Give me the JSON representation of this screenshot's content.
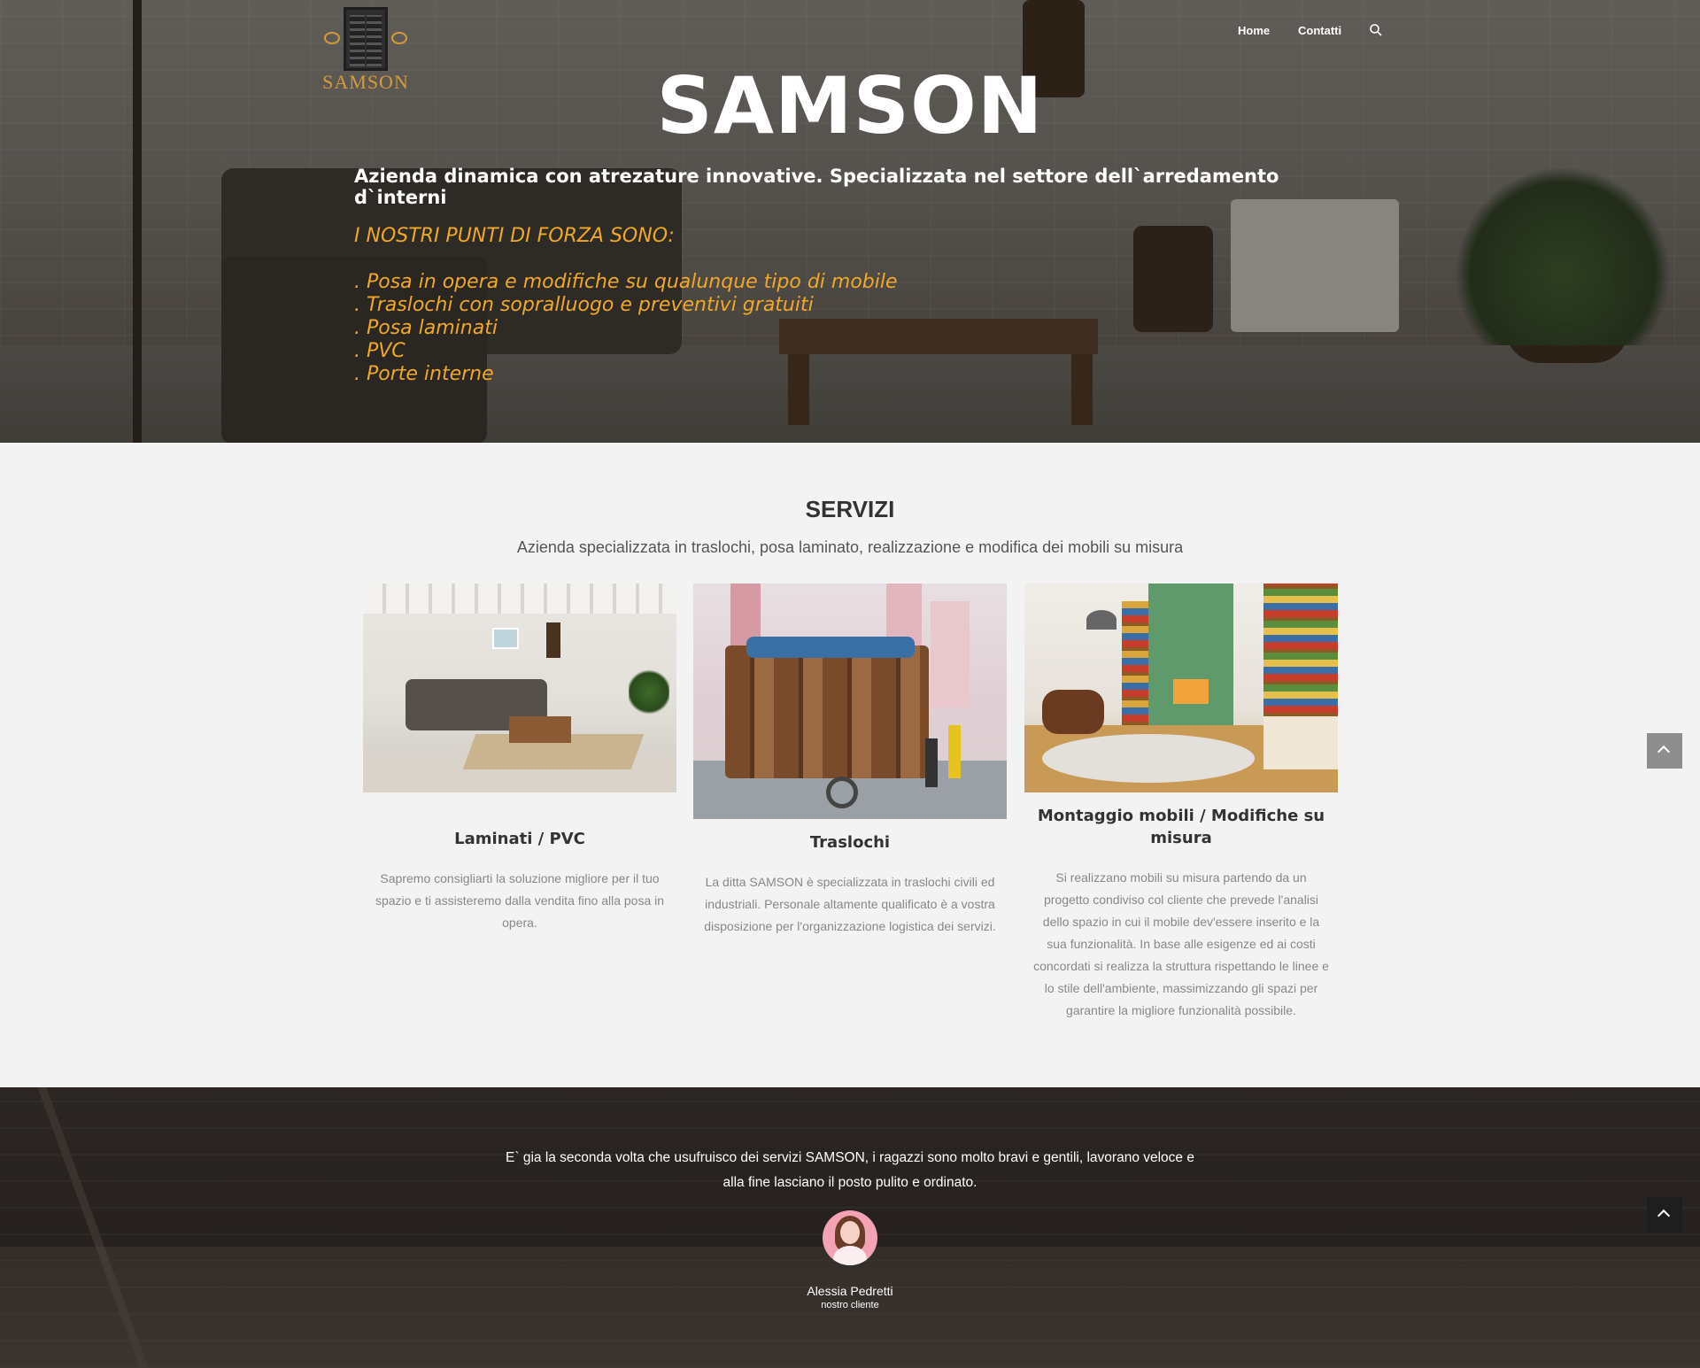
{
  "header": {
    "logo_text": "SAMSON",
    "nav": {
      "home": "Home",
      "contatti": "Contatti"
    },
    "search_icon": "search-icon"
  },
  "hero": {
    "title": "SAMSON",
    "subtitle": "Azienda dinamica con atrezature innovative. Specializzata nel settore dell`arredamento d`interni",
    "strengths_heading": "I NOSTRI PUNTI DI FORZA SONO:",
    "strengths": [
      ". Posa in opera e modifiche su qualunque tipo di mobile",
      ". Traslochi con sopralluogo e preventivi gratuiti",
      ". Posa laminati",
      ". PVC",
      ". Porte interne"
    ],
    "accent_color": "#f0a826"
  },
  "services": {
    "title": "SERVIZI",
    "subtitle": "Azienda specializzata in traslochi, posa laminato, realizzazione e modifica dei mobili su misura",
    "cards": [
      {
        "title": "Laminati / PVC",
        "text": "Sapremo consigliarti la soluzione migliore per il tuo spazio e ti assisteremo dalla vendita fino alla posa in opera."
      },
      {
        "title": "Traslochi",
        "text": "La ditta SAMSON è specializzata in traslochi civili ed industriali. Personale altamente qualificato è a vostra disposizione per l'organizzazione logistica dei servizi."
      },
      {
        "title": "Montaggio mobili / Modifiche su misura",
        "text": "Si realizzano mobili su misura partendo da un progetto condiviso col cliente che prevede l'analisi dello spazio in cui il mobile dev'essere inserito e la sua funzionalità. In base alle esigenze ed ai costi concordati si realizza la struttura rispettando le linee e lo stile dell'ambiente, massimizzando gli spazi per garantire la migliore funzionalità possibile."
      }
    ]
  },
  "testimonial": {
    "quote": "E` gia la seconda volta che usufruisco dei servizi SAMSON, i ragazzi sono molto bravi e gentili, lavorano veloce e alla fine lasciano il posto pulito e ordinato.",
    "author": "Alessia Pedretti",
    "role": "nostro cliente"
  },
  "scroll_top_icon": "chevron-up-icon"
}
